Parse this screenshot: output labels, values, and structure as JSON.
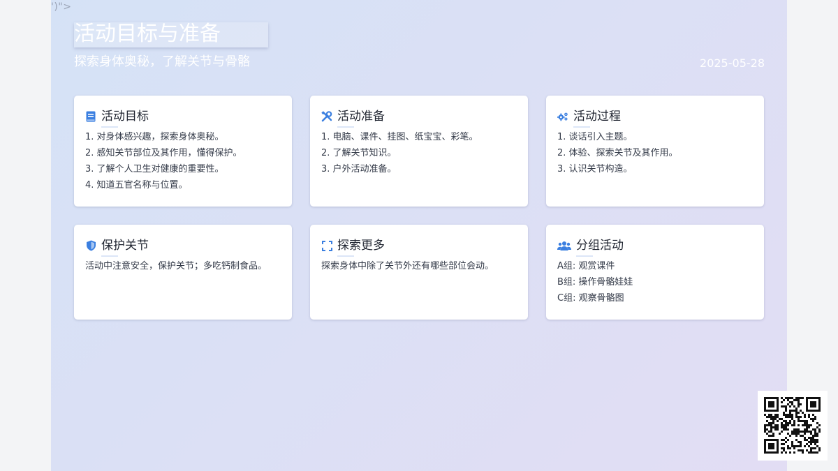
{
  "stray_text": "')\">",
  "header": {
    "title": "活动目标与准备",
    "subtitle": "探索身体奥秘，了解关节与骨骼",
    "date": "2025-05-28"
  },
  "cards": [
    {
      "icon": "book-icon",
      "title": "活动目标",
      "items": [
        "1. 对身体感兴趣，探索身体奥秘。",
        "2. 感知关节部位及其作用，懂得保护。",
        "3. 了解个人卫生对健康的重要性。",
        "4. 知道五官名称与位置。"
      ]
    },
    {
      "icon": "tools-icon",
      "title": "活动准备",
      "items": [
        "1. 电脑、课件、挂图、纸宝宝、彩笔。",
        "2. 了解关节知识。",
        "3. 户外活动准备。"
      ]
    },
    {
      "icon": "gears-icon",
      "title": "活动过程",
      "items": [
        "1. 谈话引入主题。",
        "2. 体验、探索关节及其作用。",
        "3. 认识关节构造。"
      ]
    },
    {
      "icon": "shield-icon",
      "title": "保护关节",
      "items": [
        "活动中注意安全，保护关节；多吃钙制食品。"
      ]
    },
    {
      "icon": "expand-icon",
      "title": "探索更多",
      "items": [
        "探索身体中除了关节外还有哪些部位会动。"
      ]
    },
    {
      "icon": "users-icon",
      "title": "分组活动",
      "items": [
        "A组: 观赏课件",
        "B组: 操作骨骼娃娃",
        "C组: 观察骨骼图"
      ]
    }
  ],
  "colors": {
    "accent": "#3b7fe0",
    "card_bg": "#ffffff",
    "text": "#333a48",
    "header_text": "#ffffff"
  }
}
